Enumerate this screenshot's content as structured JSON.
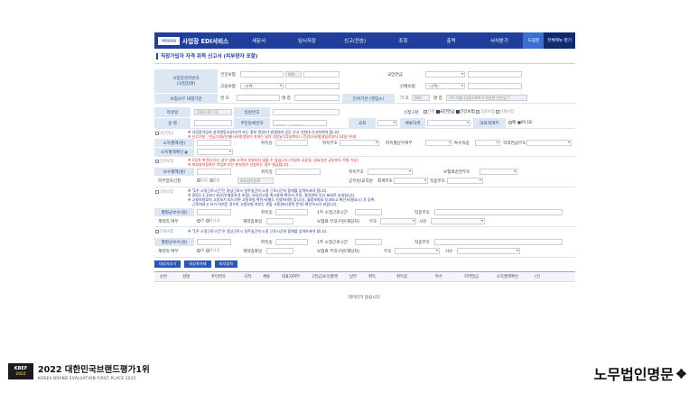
{
  "nav": {
    "logo": "국민연금공단",
    "brand": "사업장 EDI서비스",
    "items": [
      "새문서",
      "임시저장",
      "신고(전송)",
      "조회",
      "출력",
      "서식받기"
    ],
    "help": "도움말",
    "all_menu": "전체메뉴 열기"
  },
  "page_title": "직장가입자 자격 취득 신고서 (피부양자 포함)",
  "biz": {
    "label_mgmt": "사업장관리번호",
    "label_mgmt2": "(사업장명)",
    "health": "건강보험",
    "health_val": "000",
    "employ": "고용보험",
    "employ_sel": "--선택--",
    "pension": "국민연금",
    "sanjae": "산재보험",
    "sanjae_sel": "--선택--",
    "agency_label": "보험사무 대행기관",
    "agency_num": "번 호",
    "agency_name": "명 칭",
    "unit_label": "단위기관 (영업소)",
    "unit_sign": "기 호",
    "unit_code": "000",
    "unit_name_label": "명 칭",
    "unit_name": "(주) 미탑-(일동)349 V 목당천-산탄업 T"
  },
  "person": {
    "write_date_label": "작성일",
    "write_date": "2022-07-13",
    "serial_label": "일련번호",
    "report_label": "신청구분",
    "opt_all": "전체",
    "opt_pension": "국민연금",
    "opt_health": "건강보험",
    "opt_employ": "고용보험",
    "opt_sanjae": "산재보험",
    "name_label": "성 명",
    "rrn_label": "주민등록번호",
    "rrn_val": "______ - _______",
    "nation_label": "국적",
    "visa_label": "체류자격",
    "rep_label": "대표자여부",
    "rep_yes": "예",
    "rep_no": "아니요"
  },
  "pension": {
    "section": "국민연금",
    "note1": "※ 사업장가입자 자격변동사유(자격 또는 정보 변경)가 발생하여 공무 신고 기한내 신고하여야 합니다.",
    "note2": "※ 신고기한 : 연금/고용/산재(사유발생일이 속하는 달의 다음달 15일까지) / 건강(사유발생일로부터 14일 이내)",
    "income_label": "소득월액(원)",
    "acq_date_label": "취득일",
    "acq_code_label": "취득부호",
    "acq_month_label": "취득월납부여부",
    "special_label": "특수직종",
    "job_label": "직역연금부호",
    "income_check_label": "소득월액확인"
  },
  "health": {
    "section": "건강보험",
    "note1": "※ 1일차 취득의 아닌 경우 날짜 고객의 부영되지 않을 수 있습니다.(기업의 공휴일, 일요일은 공부하도 적용 가능)",
    "note2": "※ 피부양자등록은 가입자 또는 본부원이 신청하는 경우 발급합니다.",
    "pay_label": "보수월액(원)",
    "acq_date_label": "취득일",
    "acq_code_label": "취득부호",
    "reduce_label": "보험료감면부호",
    "dependent_label": "피부양자신청",
    "dep_yes": "있음",
    "dep_no": "없음",
    "dep_reg": "피부양자등록",
    "public_label": "공무원/교직원",
    "account_label": "회계부호",
    "job_label": "직종부호"
  },
  "employ": {
    "section": "고용보험",
    "note1": "※ \"1주 소정근로시간\"은 정상근로시 일주일간의 소정 근로시간의 합계를 입력하셔야 합니다.",
    "note2": "※ 2011.1.1부터 외국인(체류자격 포함), 외국인고용 취사용에 확인서 주의, 결격관의 투서 표대로 부과됩니다.",
    "note3": "※ 고용보험료의 고용보기 피드라면 고용보험 확인서(별도 신청하여야 합니다), 월정보험료 부과되고 확인서(필요시) 후 등록.",
    "note4": "근로자라고 보기 어려운 경우만 고용보험 여부는 관할 고용센터(관련 문의) 확인하시기 바랍니다.",
    "wage_label": "월평균보수(원)",
    "acq_date_label": "취득일",
    "hours_label": "1주 소정근로시간",
    "jobcode_label": "직종부호",
    "contract_label": "계약직 여부",
    "contract_yes": "예",
    "contract_no": "아니요",
    "contract_end_label": "계약종료일",
    "levy_label": "보험료 부과구분(해당자)",
    "levy_code": "부호",
    "reason_label": "사유"
  },
  "sanjae": {
    "section": "산재보험",
    "note1": "※ \"1주 소정근로시간\"은 정상근로시 일주일간의 소정 근로시간의 합계를 입력하셔야 합니다.",
    "wage_label": "월평균보수(원)",
    "acq_date_label": "취득일",
    "hours_label": "1주 소정근로시간",
    "jobcode_label": "직종부호",
    "contract_label": "계약직 여부",
    "contract_yes": "예",
    "contract_no": "아니요",
    "contract_end_label": "계약종료일",
    "levy_label": "보험료 부과구분(해당자)",
    "levy_code": "부호",
    "reason_label": "사유"
  },
  "actions": {
    "add": "대상자추가",
    "delete": "대상자삭제",
    "dependent": "피부양자"
  },
  "table": {
    "headers": [
      "순번",
      "성명",
      "주민번호",
      "국적",
      "체류",
      "대표자여부",
      "[연금]소득월액",
      "납부",
      "취득",
      "취득일",
      "특수",
      "직역연금",
      "소득월액확인",
      "(건"
    ],
    "empty": "데이터가 없습니다."
  },
  "footer": {
    "kbef_badge": "KBEF",
    "kbef_year": "2022",
    "kbef_title": "2022 대한민국브랜드평가1위",
    "kbef_sub": "KOREA BRAND EVALUATION FIRST PLACE 2022",
    "nomu": "노무법인명문"
  }
}
